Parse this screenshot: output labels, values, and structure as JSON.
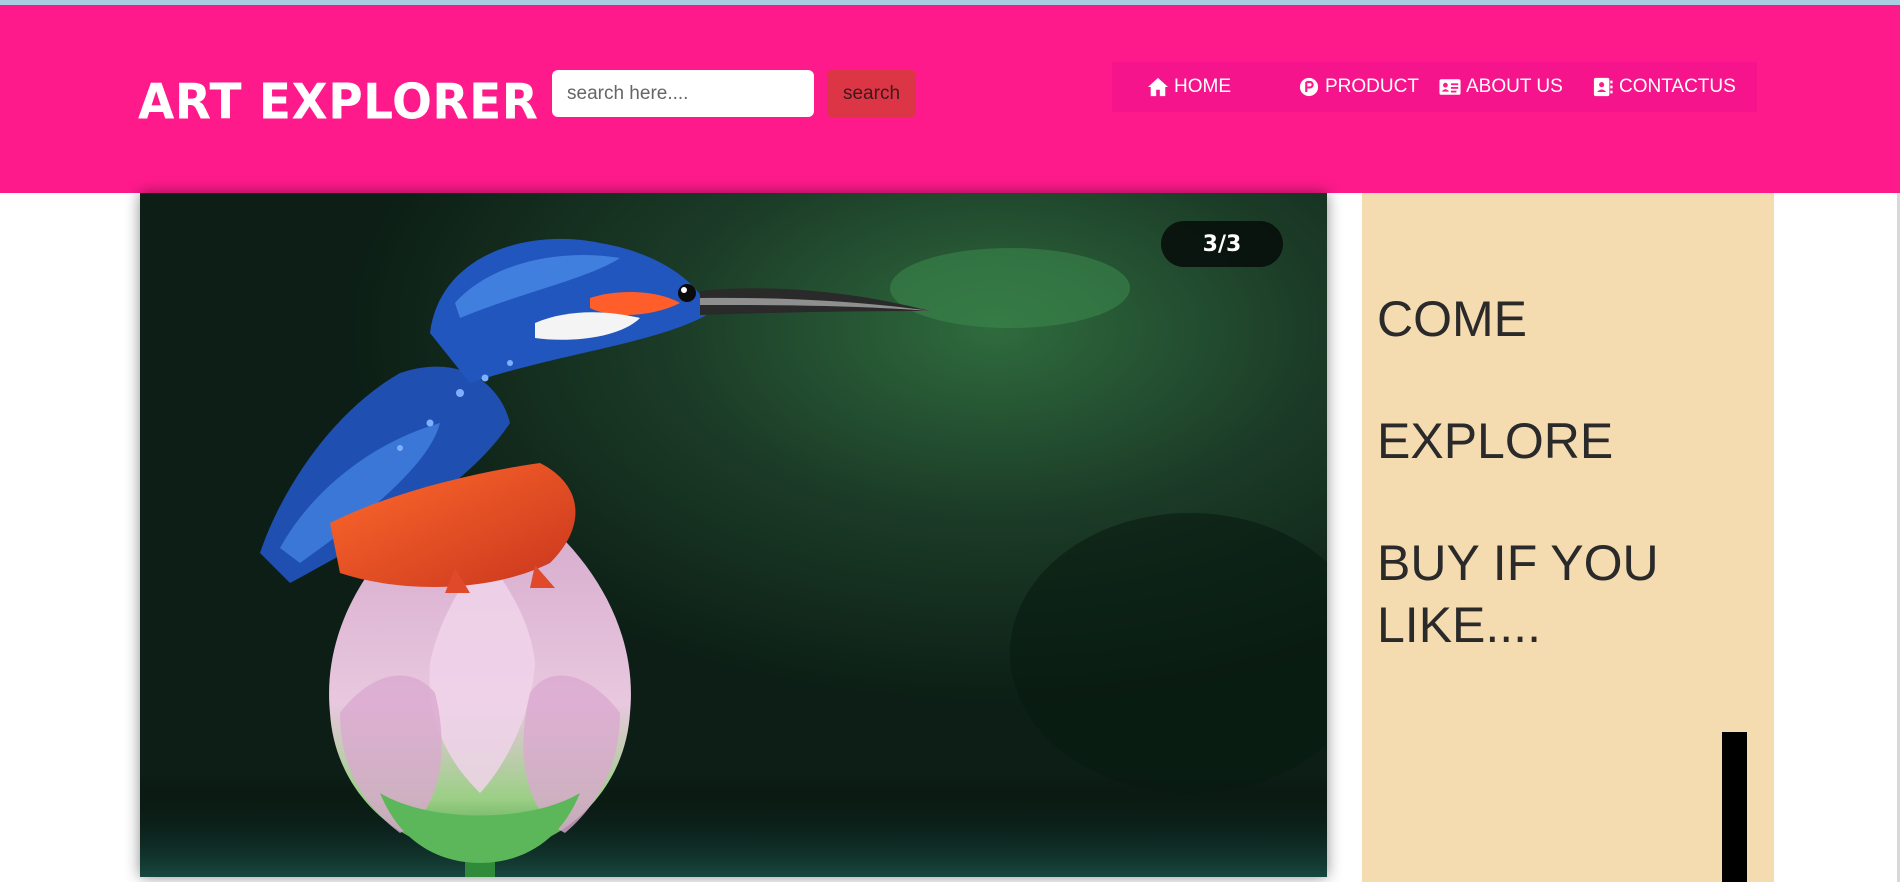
{
  "header": {
    "brand": "ART EXPLORER",
    "search_placeholder": "search here....",
    "search_button": "search",
    "nav": [
      {
        "label": "HOME",
        "icon": "home-icon"
      },
      {
        "label": "PRODUCT",
        "icon": "product-p-icon"
      },
      {
        "label": "ABOUT US",
        "icon": "id-card-icon"
      },
      {
        "label": "CONTACTUS",
        "icon": "contact-book-icon"
      }
    ]
  },
  "carousel": {
    "counter": "3/3",
    "slide_subject": "kingfisher-on-lotus-painting"
  },
  "side_panel": {
    "lines": [
      "COME",
      "EXPLORE",
      "BUY IF YOU LIKE...."
    ]
  },
  "colors": {
    "header_bg": "#ff1a8c",
    "search_button_bg": "#dc3545",
    "panel_bg": "#f5dbb0"
  }
}
